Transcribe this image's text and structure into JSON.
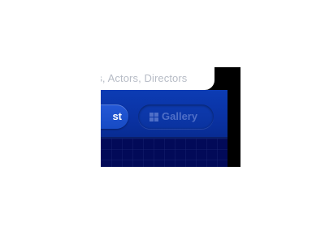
{
  "search": {
    "placeholder": "Movies, Actors, Directors",
    "visible_text": "es, Actors, Directors"
  },
  "toolbar": {
    "list_label_visible": "st",
    "gallery_label": "Gallery",
    "gallery_icon": "grid-icon"
  },
  "colors": {
    "toolbar_blue": "#0a32a3",
    "active_button": "#1f52cf",
    "inactive_label": "#4f6fc7",
    "grid_background": "#020a58"
  }
}
